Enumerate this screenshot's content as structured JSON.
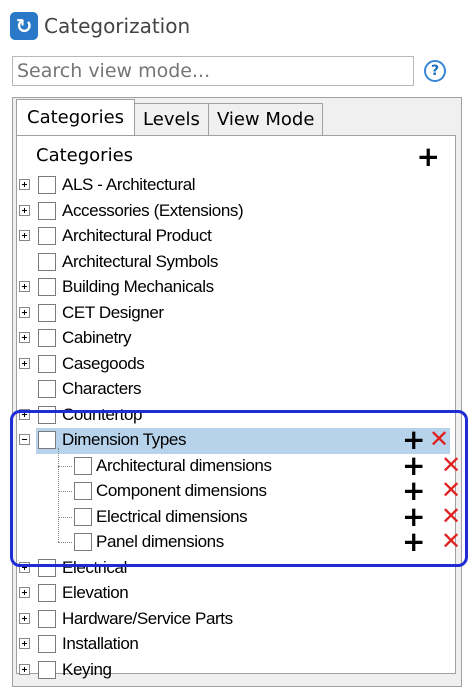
{
  "window": {
    "title": "Categorization"
  },
  "search": {
    "placeholder": "Search view mode...",
    "value": ""
  },
  "help": {
    "label": "?"
  },
  "tabs": [
    {
      "label": "Categories",
      "active": true
    },
    {
      "label": "Levels",
      "active": false
    },
    {
      "label": "View Mode",
      "active": false
    }
  ],
  "tree": {
    "header": "Categories",
    "items": [
      {
        "label": "ALS - Architectural",
        "expander": "plus"
      },
      {
        "label": "Accessories (Extensions)",
        "expander": "plus"
      },
      {
        "label": "Architectural Product",
        "expander": "plus"
      },
      {
        "label": "Architectural Symbols",
        "expander": "none"
      },
      {
        "label": "Building Mechanicals",
        "expander": "plus"
      },
      {
        "label": "CET Designer",
        "expander": "plus"
      },
      {
        "label": "Cabinetry",
        "expander": "plus"
      },
      {
        "label": "Casegoods",
        "expander": "plus"
      },
      {
        "label": "Characters",
        "expander": "none"
      },
      {
        "label": "Countertop",
        "expander": "plus"
      },
      {
        "label": "Dimension Types",
        "expander": "minus",
        "selected": true,
        "children": [
          {
            "label": "Architectural dimensions"
          },
          {
            "label": "Component dimensions"
          },
          {
            "label": "Electrical dimensions"
          },
          {
            "label": "Panel dimensions"
          }
        ]
      },
      {
        "label": "Electrical",
        "expander": "plus"
      },
      {
        "label": "Elevation",
        "expander": "plus"
      },
      {
        "label": "Hardware/Service Parts",
        "expander": "plus"
      },
      {
        "label": "Installation",
        "expander": "plus"
      },
      {
        "label": "Keying",
        "expander": "plus"
      }
    ]
  },
  "colors": {
    "accent": "#2a78c8",
    "selection": "#b7d3ec",
    "highlight_border": "#1f2bd6",
    "remove": "#e0201f"
  },
  "icons": {
    "app": "categorization-icon",
    "add": "plus-icon",
    "remove": "x-icon",
    "help": "question-icon"
  }
}
